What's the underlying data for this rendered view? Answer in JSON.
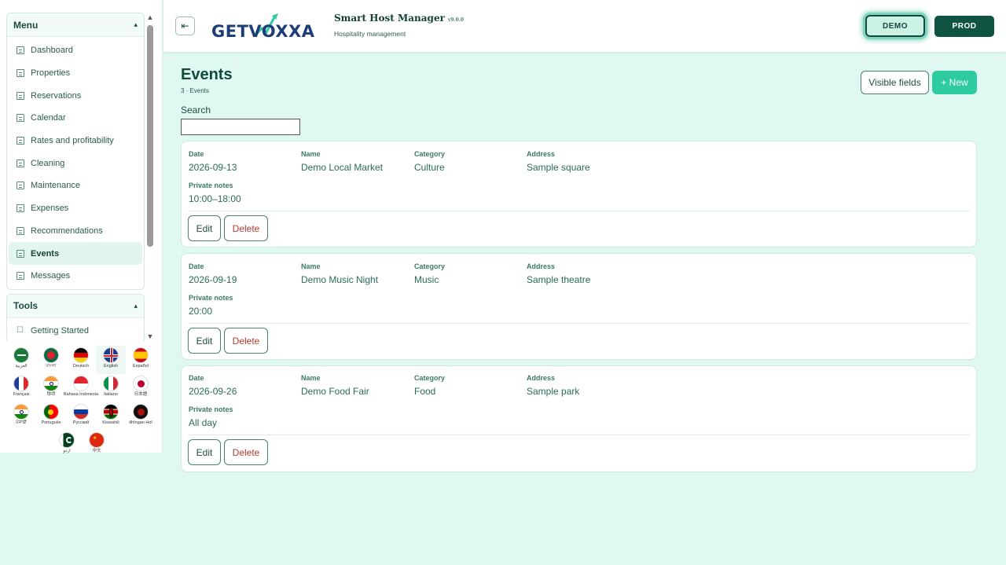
{
  "sidebar": {
    "menu_title": "Menu",
    "menu_items": [
      {
        "label": "Dashboard"
      },
      {
        "label": "Properties"
      },
      {
        "label": "Reservations"
      },
      {
        "label": "Calendar"
      },
      {
        "label": "Rates and profitability"
      },
      {
        "label": "Cleaning"
      },
      {
        "label": "Maintenance"
      },
      {
        "label": "Expenses"
      },
      {
        "label": "Recommendations"
      },
      {
        "label": "Events",
        "active": true
      },
      {
        "label": "Messages"
      }
    ],
    "tools_title": "Tools",
    "tools_items": [
      {
        "label": "Getting Started"
      }
    ],
    "languages": [
      {
        "label": "العربية",
        "flag": "sa"
      },
      {
        "label": "বাংলা",
        "flag": "bd"
      },
      {
        "label": "Deutsch",
        "flag": "de"
      },
      {
        "label": "English",
        "flag": "gb",
        "selected": true
      },
      {
        "label": "Español",
        "flag": "es"
      },
      {
        "label": "Français",
        "flag": "fr"
      },
      {
        "label": "हिन्दी",
        "flag": "in"
      },
      {
        "label": "Bahasa Indonesia",
        "flag": "id"
      },
      {
        "label": "Italiano",
        "flag": "it"
      },
      {
        "label": "日本語",
        "flag": "jp"
      },
      {
        "label": "ਪੰਜਾਬੀ",
        "flag": "in2"
      },
      {
        "label": "Português",
        "flag": "pt"
      },
      {
        "label": "Русский",
        "flag": "ru"
      },
      {
        "label": "Kiswahili",
        "flag": "ke"
      },
      {
        "label": "tlhIngan Hol",
        "flag": "kl"
      },
      {
        "label": "اردو",
        "flag": "pk"
      },
      {
        "label": "中文",
        "flag": "cn"
      }
    ]
  },
  "header": {
    "logo_text": "GETVOXXA",
    "app_title": "Smart Host Manager",
    "app_version": "v9.0.0",
    "app_subtitle": "Hospitality management",
    "env_demo": "DEMO",
    "env_prod": "PROD"
  },
  "main": {
    "title": "Events",
    "subtitle": "3 · Events",
    "visible_fields_label": "Visible fields",
    "new_label": "+ New",
    "search_label": "Search",
    "search_value": "",
    "field_labels": {
      "date": "Date",
      "name": "Name",
      "category": "Category",
      "address": "Address",
      "notes": "Private notes"
    },
    "edit_label": "Edit",
    "delete_label": "Delete",
    "events": [
      {
        "date": "2026-09-13",
        "name": "Demo Local Market",
        "category": "Culture",
        "address": "Sample square",
        "notes": "10:00–18:00"
      },
      {
        "date": "2026-09-19",
        "name": "Demo Music Night",
        "category": "Music",
        "address": "Sample theatre",
        "notes": "20:00"
      },
      {
        "date": "2026-09-26",
        "name": "Demo Food Fair",
        "category": "Food",
        "address": "Sample park",
        "notes": "All day"
      }
    ]
  }
}
